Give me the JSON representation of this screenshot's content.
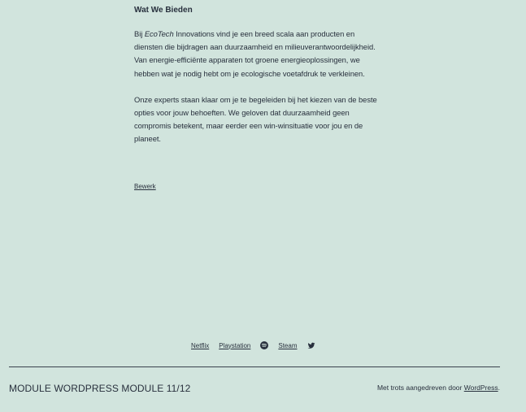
{
  "article": {
    "heading": "Wat We Bieden",
    "para1_prefix": "Bij ",
    "para1_brand": "EcoTech",
    "para1_rest": " Innovations vind je een breed scala aan producten en diensten die bijdragen aan duurzaamheid en milieuverantwoordelijkheid. Van energie-efficiënte apparaten tot groene energieoplossingen, we hebben wat je nodig hebt om je ecologische voetafdruk te verkleinen.",
    "para2": "Onze experts staan klaar om je te begeleiden bij het kiezen van de beste opties voor jouw behoeften. We geloven dat duurzaamheid geen compromis betekent, maar eerder een win-winsituatie voor jou en de planeet.",
    "edit_label": "Bewerk"
  },
  "social": {
    "items": [
      {
        "label": "Netflix"
      },
      {
        "label": "Playstation"
      },
      {
        "icon": "spotify-icon"
      },
      {
        "label": "Steam"
      },
      {
        "icon": "twitter-icon"
      }
    ]
  },
  "footer": {
    "site_title": "MODULE WORDPRESS MODULE 11/12",
    "powered_prefix": "Met trots aangedreven door ",
    "powered_link": "WordPress",
    "powered_suffix": "."
  },
  "colors": {
    "background": "#d1e4dd",
    "text": "#28303d"
  }
}
